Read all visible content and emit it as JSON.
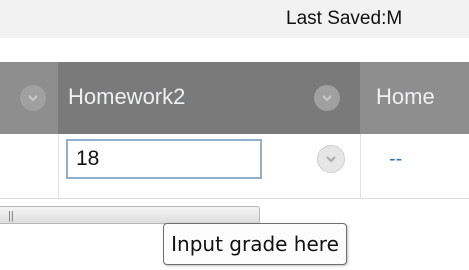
{
  "toolbar": {
    "last_saved_text": "Last Saved:M"
  },
  "grid": {
    "columns": [
      {
        "label": ""
      },
      {
        "label": "Homework2"
      },
      {
        "label": "Home"
      }
    ],
    "row": {
      "grade_input_value": "18",
      "next_cell_text": "--"
    }
  },
  "tooltip": {
    "text": "Input grade here"
  },
  "scrollbar": {
    "grip_text": "||"
  },
  "icons": {
    "column_menu": "chevron-down-icon",
    "cell_menu": "chevron-down-icon"
  },
  "colors": {
    "header_bg": "#8e8e8e",
    "header_active_bg": "#7a7a7a",
    "link_blue": "#3a73b8",
    "input_border": "#8fb0cf"
  }
}
